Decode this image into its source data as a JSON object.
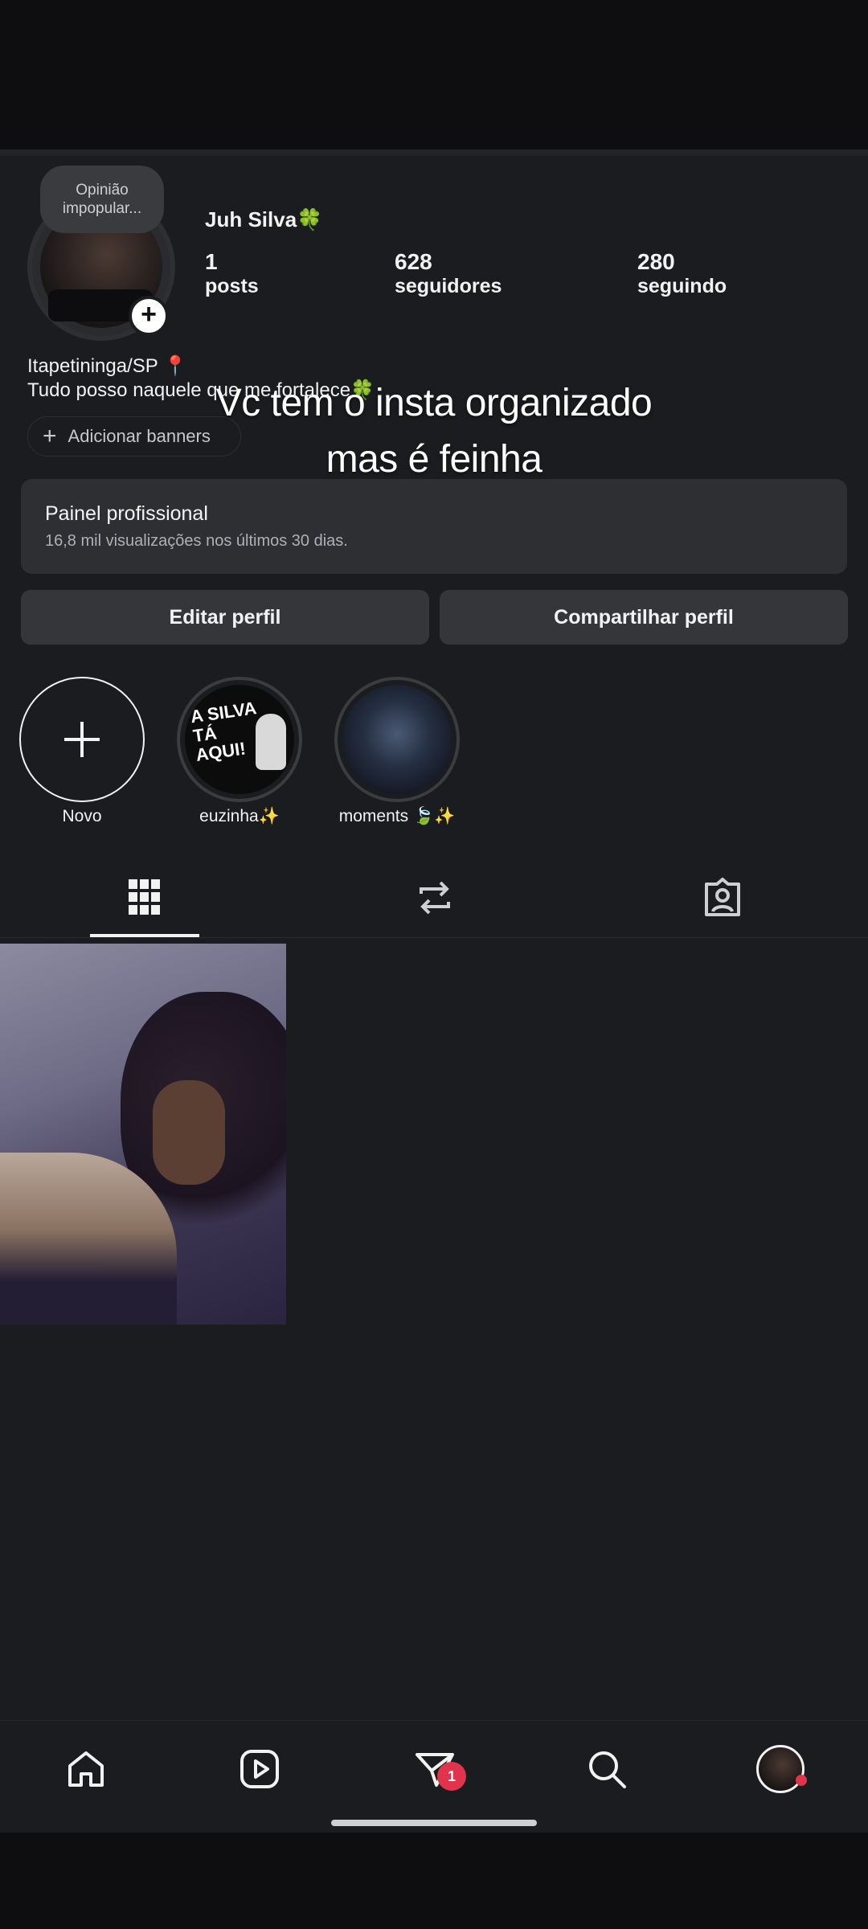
{
  "profile": {
    "note": "Opinião impopular...",
    "display_name": "Juh Silva🍀",
    "stats": [
      {
        "value": "1",
        "label": "posts"
      },
      {
        "value": "628",
        "label": "seguidores"
      },
      {
        "value": "280",
        "label": "seguindo"
      }
    ],
    "bio_line1": "Itapetininga/SP 📍",
    "bio_line2": "Tudo posso naquele que me fortalece🍀",
    "add_banners": "Adicionar banners"
  },
  "overlay": {
    "line1": "Vc tem o insta organizado",
    "line2": "mas é feinha"
  },
  "pro_panel": {
    "title": "Painel profissional",
    "subtitle": "16,8 mil visualizações nos últimos 30 dias."
  },
  "buttons": {
    "edit": "Editar perfil",
    "share": "Compartilhar perfil"
  },
  "highlights": [
    {
      "label": "Novo",
      "icon": "plus-icon"
    },
    {
      "label": "euzinha✨",
      "cover_text": "A SILVA TÁ AQUI!"
    },
    {
      "label": "moments 🍃✨"
    }
  ],
  "tabs": [
    "grid-icon",
    "reposts-icon",
    "tagged-icon"
  ],
  "navbar": {
    "icons": [
      "home-icon",
      "reels-icon",
      "messages-icon",
      "search-icon",
      "profile-avatar"
    ],
    "messages_badge": "1"
  },
  "colors": {
    "background": "#1b1c1f",
    "panel": "#2d2f33",
    "button": "#34363a",
    "badge": "#e0334c"
  }
}
